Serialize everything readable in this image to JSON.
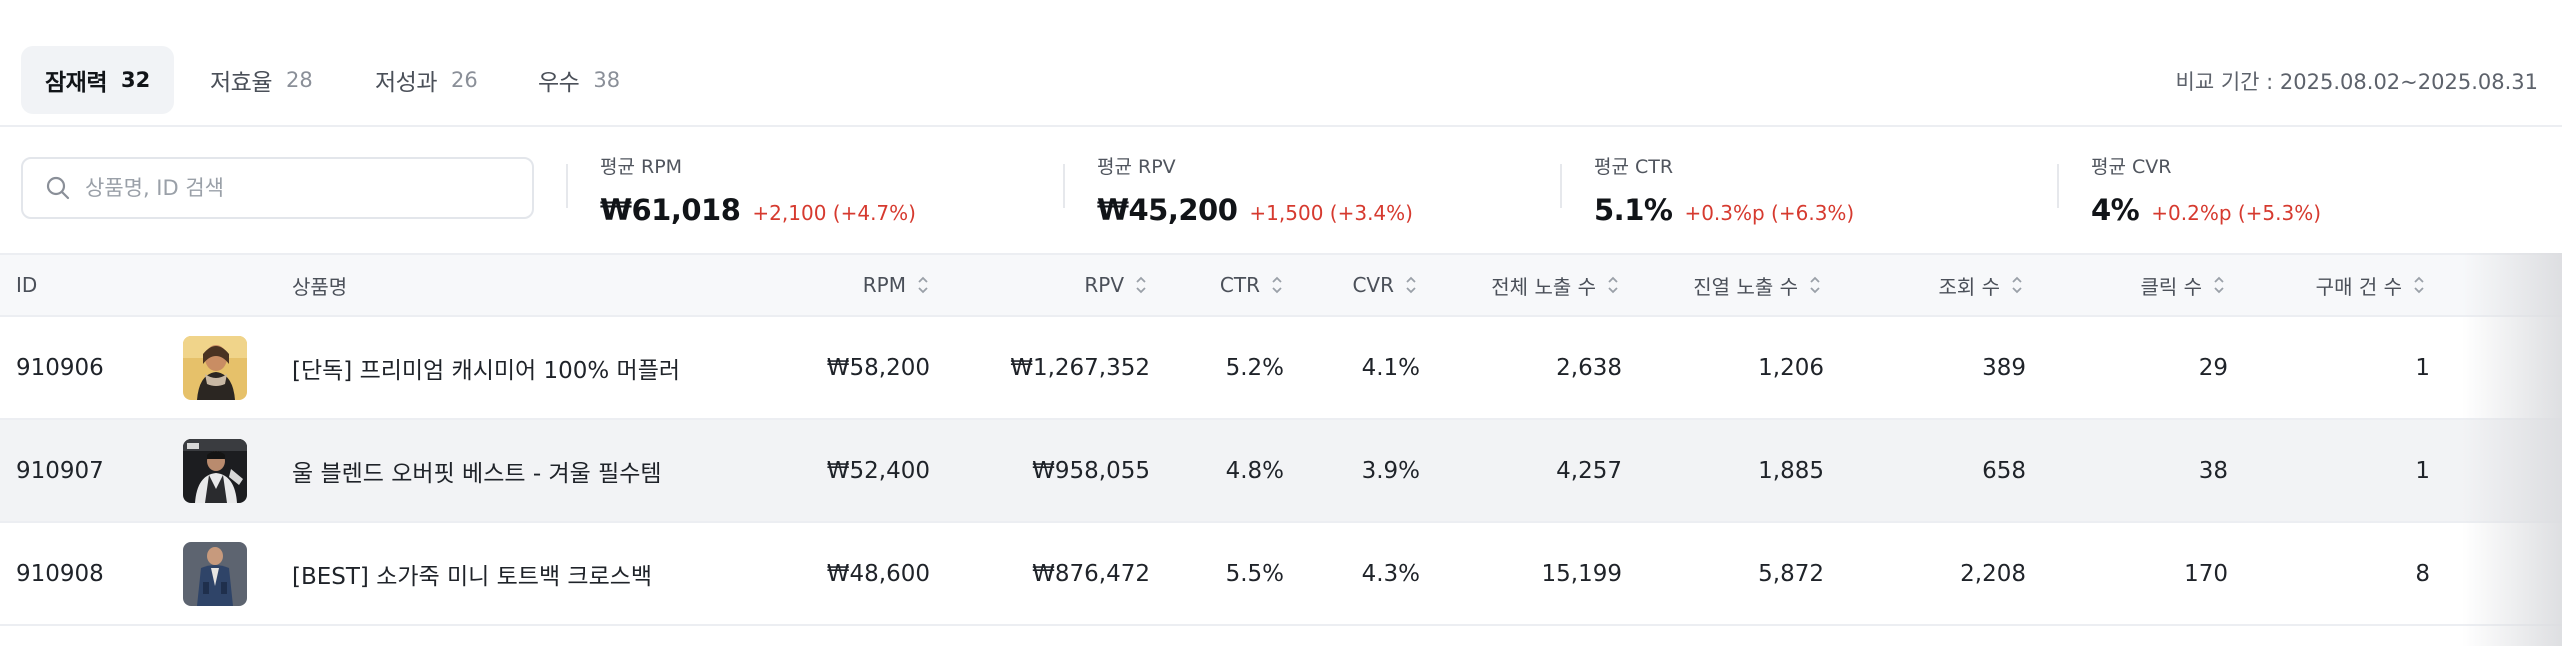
{
  "tabs": [
    {
      "label": "잠재력",
      "count": "32",
      "active": true
    },
    {
      "label": "저효율",
      "count": "28",
      "active": false
    },
    {
      "label": "저성과",
      "count": "26",
      "active": false
    },
    {
      "label": "우수",
      "count": "38",
      "active": false
    }
  ],
  "compare_period": "비교 기간 : 2025.08.02~2025.08.31",
  "search": {
    "placeholder": "상품명, ID 검색",
    "value": ""
  },
  "stats": [
    {
      "label": "평균 RPM",
      "value": "₩61,018",
      "delta": "+2,100 (+4.7%)"
    },
    {
      "label": "평균 RPV",
      "value": "₩45,200",
      "delta": "+1,500 (+3.4%)"
    },
    {
      "label": "평균 CTR",
      "value": "5.1%",
      "delta": "+0.3%p (+6.3%)"
    },
    {
      "label": "평균 CVR",
      "value": "4%",
      "delta": "+0.2%p (+5.3%)"
    }
  ],
  "table": {
    "headers": {
      "id": "ID",
      "name": "상품명",
      "rpm": "RPM",
      "rpv": "RPV",
      "ctr": "CTR",
      "cvr": "CVR",
      "total_impressions": "전체 노출 수",
      "display_impressions": "진열 노출 수",
      "views": "조회 수",
      "clicks": "클릭 수",
      "purchases": "구매 건 수"
    },
    "rows": [
      {
        "id": "910906",
        "thumb": "scarf-product-thumbnail",
        "name": "[단독] 프리미엄 캐시미어 100% 머플러",
        "rpm": "₩58,200",
        "rpv": "₩1,267,352",
        "ctr": "5.2%",
        "cvr": "4.1%",
        "total_impressions": "2,638",
        "display_impressions": "1,206",
        "views": "389",
        "clicks": "29",
        "purchases": "1"
      },
      {
        "id": "910907",
        "thumb": "vest-product-thumbnail",
        "name": "울 블렌드 오버핏 베스트 - 겨울 필수템",
        "rpm": "₩52,400",
        "rpv": "₩958,055",
        "ctr": "4.8%",
        "cvr": "3.9%",
        "total_impressions": "4,257",
        "display_impressions": "1,885",
        "views": "658",
        "clicks": "38",
        "purchases": "1"
      },
      {
        "id": "910908",
        "thumb": "bag-product-thumbnail",
        "name": "[BEST] 소가죽 미니 토트백 크로스백",
        "rpm": "₩48,600",
        "rpv": "₩876,472",
        "ctr": "5.5%",
        "cvr": "4.3%",
        "total_impressions": "15,199",
        "display_impressions": "5,872",
        "views": "2,208",
        "clicks": "170",
        "purchases": "8"
      }
    ]
  },
  "colors": {
    "accent_negative": "#d63a2f",
    "active_tab_bg": "#f1f3f6",
    "header_bg": "#f7f8fa",
    "row_alt_bg": "#f2f3f5"
  }
}
